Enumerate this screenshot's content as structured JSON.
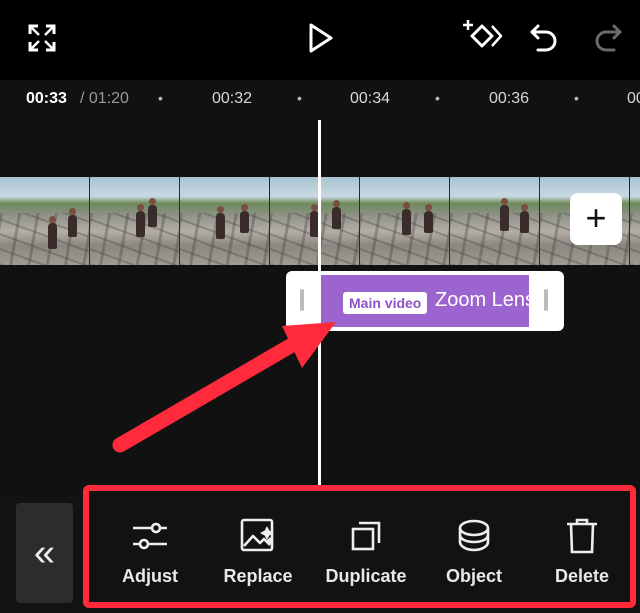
{
  "colors": {
    "accent_purple": "#9c64cf",
    "annotation_red": "#ff2a3c",
    "background": "#000000",
    "toolbar": "#121212"
  },
  "top_bar": {
    "icons": [
      "fullscreen-icon",
      "play-icon",
      "keyframe-icon",
      "undo-icon",
      "redo-icon"
    ]
  },
  "ruler": {
    "current_time": "00:33",
    "duration": "/ 01:20",
    "ticks": [
      "00:32",
      "00:34",
      "00:36",
      "00"
    ],
    "dot": "•"
  },
  "timeline": {
    "add_label": "+",
    "clip": {
      "tag": "Main video",
      "title": "Zoom Lens"
    }
  },
  "toolbar": {
    "collapse_label": "«",
    "items": [
      {
        "label": "Adjust",
        "icon": "sliders-icon"
      },
      {
        "label": "Replace",
        "icon": "replace-image-icon"
      },
      {
        "label": "Duplicate",
        "icon": "duplicate-icon"
      },
      {
        "label": "Object",
        "icon": "cylinder-icon"
      },
      {
        "label": "Delete",
        "icon": "trash-icon"
      }
    ]
  }
}
